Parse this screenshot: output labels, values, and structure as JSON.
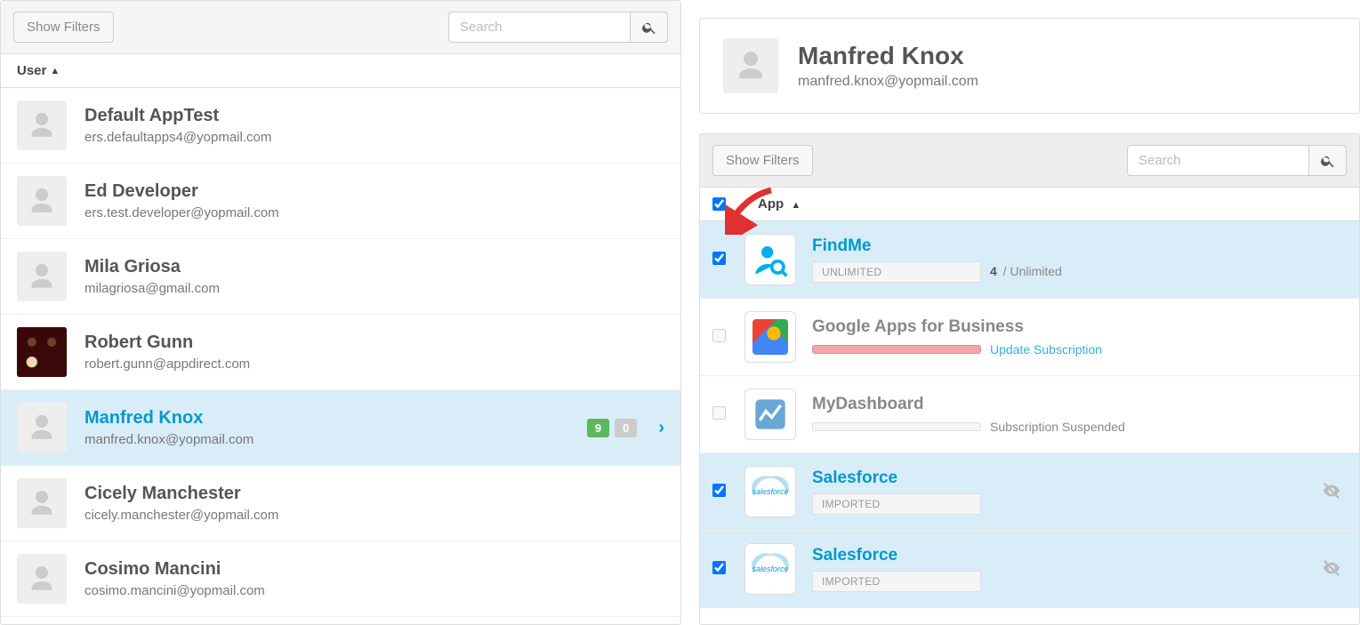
{
  "left": {
    "show_filters": "Show Filters",
    "search_placeholder": "Search",
    "column_header": "User",
    "users": [
      {
        "name": "Default AppTest",
        "email": "ers.defaultapps4@yopmail.com",
        "photo": false,
        "selected": false
      },
      {
        "name": "Ed Developer",
        "email": "ers.test.developer@yopmail.com",
        "photo": false,
        "selected": false
      },
      {
        "name": "Mila Griosa",
        "email": "milagriosa@gmail.com",
        "photo": false,
        "selected": false
      },
      {
        "name": "Robert Gunn",
        "email": "robert.gunn@appdirect.com",
        "photo": true,
        "selected": false
      },
      {
        "name": "Manfred Knox",
        "email": "manfred.knox@yopmail.com",
        "photo": false,
        "selected": true,
        "badge_green": "9",
        "badge_gray": "0"
      },
      {
        "name": "Cicely Manchester",
        "email": "cicely.manchester@yopmail.com",
        "photo": false,
        "selected": false
      },
      {
        "name": "Cosimo Mancini",
        "email": "cosimo.mancini@yopmail.com",
        "photo": false,
        "selected": false
      }
    ]
  },
  "right": {
    "profile": {
      "name": "Manfred Knox",
      "email": "manfred.knox@yopmail.com"
    },
    "show_filters": "Show Filters",
    "search_placeholder": "Search",
    "column_header": "App",
    "select_all_checked": true,
    "apps": [
      {
        "name": "FindMe",
        "checked": true,
        "selected": true,
        "icon": "findme",
        "pill": "UNLIMITED",
        "pill_style": "",
        "meta_count": "4",
        "meta_suffix": " / Unlimited"
      },
      {
        "name": "Google Apps for Business",
        "checked": false,
        "selected": false,
        "icon": "google",
        "pill": "",
        "pill_style": "red",
        "meta_link": "Update Subscription"
      },
      {
        "name": "MyDashboard",
        "checked": false,
        "selected": false,
        "icon": "dash",
        "pill": "",
        "pill_style": "",
        "meta_text": "Subscription Suspended"
      },
      {
        "name": "Salesforce",
        "checked": true,
        "selected": true,
        "icon": "sf",
        "pill": "IMPORTED",
        "pill_style": "",
        "action_icon": true
      },
      {
        "name": "Salesforce",
        "checked": true,
        "selected": true,
        "icon": "sf",
        "pill": "IMPORTED",
        "pill_style": "",
        "action_icon": true
      }
    ]
  }
}
